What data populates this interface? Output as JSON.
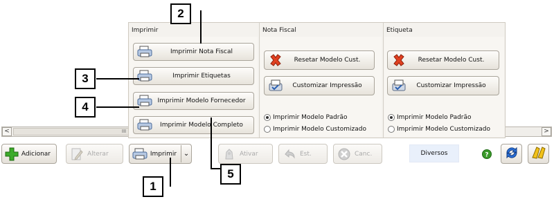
{
  "menu": {
    "imprimir": {
      "title": "Imprimir",
      "buttons": [
        {
          "label": "Imprimir Nota Fiscal",
          "icon": "printer-icon"
        },
        {
          "label": "Imprimir Etiquetas",
          "icon": "printer-icon"
        },
        {
          "label": "Imprimir Modelo Fornecedor",
          "icon": "printer-icon"
        },
        {
          "label": "Imprimir Modelo Completo",
          "icon": "printer-icon"
        }
      ]
    },
    "nota_fiscal": {
      "title": "Nota Fiscal",
      "reset_label": "Resetar Modelo Cust.",
      "custom_label": "Customizar Impressão",
      "radio_padrao": "Imprimir Modelo Padrão",
      "radio_custom": "Imprimir Modelo Customizado",
      "selected": "padrao"
    },
    "etiqueta": {
      "title": "Etiqueta",
      "reset_label": "Resetar Modelo Cust.",
      "custom_label": "Customizar Impressão",
      "radio_padrao": "Imprimir Modelo Padrão",
      "radio_custom": "Imprimir Modelo Customizado",
      "selected": "padrao"
    }
  },
  "scrollbar": {
    "left_arrow": "<",
    "right_arrow": ">",
    "thumb_grip": "III"
  },
  "toolbar": {
    "adicionar": "Adicionar",
    "alterar": "Alterar",
    "imprimir": "Imprimir",
    "dropdown_arrow": "⌄",
    "ativar": "Ativar",
    "estornar": "Est.",
    "cancelar": "Canc.",
    "diversos": "Diversos"
  },
  "callouts": {
    "c1": "1",
    "c2": "2",
    "c3": "3",
    "c4": "4",
    "c5": "5"
  },
  "colors": {
    "add_green": "#3cab2a",
    "cancel_red": "#e04020",
    "help_green": "#3a9a2a",
    "refresh_blue": "#2a6fd6",
    "keys_yellow": "#f2c21a"
  }
}
